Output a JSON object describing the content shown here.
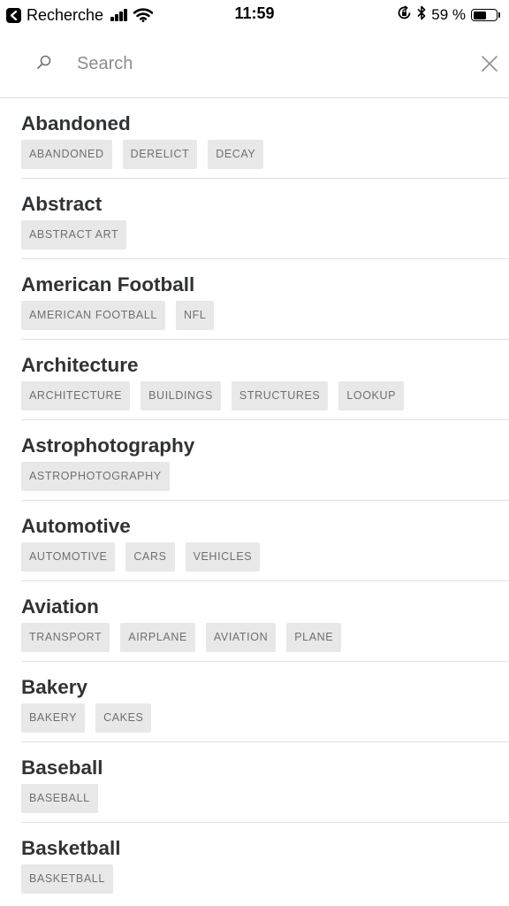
{
  "status_bar": {
    "back_app": "Recherche",
    "time": "11:59",
    "battery_text": "59 %",
    "battery_level": 0.59,
    "icons": [
      "back-arrow-icon",
      "signal-icon",
      "wifi-icon",
      "orientation-lock-icon",
      "bluetooth-icon",
      "battery-icon"
    ]
  },
  "search": {
    "placeholder": "Search",
    "value": "",
    "icons": [
      "search-icon",
      "close-icon"
    ]
  },
  "categories": [
    {
      "title": "Abandoned",
      "tags": [
        "ABANDONED",
        "DERELICT",
        "DECAY"
      ]
    },
    {
      "title": "Abstract",
      "tags": [
        "ABSTRACT ART"
      ]
    },
    {
      "title": "American Football",
      "tags": [
        "AMERICAN FOOTBALL",
        "NFL"
      ]
    },
    {
      "title": "Architecture",
      "tags": [
        "ARCHITECTURE",
        "BUILDINGS",
        "STRUCTURES",
        "LOOKUP"
      ]
    },
    {
      "title": "Astrophotography",
      "tags": [
        "ASTROPHOTOGRAPHY"
      ]
    },
    {
      "title": "Automotive",
      "tags": [
        "AUTOMOTIVE",
        "CARS",
        "VEHICLES"
      ]
    },
    {
      "title": "Aviation",
      "tags": [
        "TRANSPORT",
        "AIRPLANE",
        "AVIATION",
        "PLANE"
      ]
    },
    {
      "title": "Bakery",
      "tags": [
        "BAKERY",
        "CAKES"
      ]
    },
    {
      "title": "Baseball",
      "tags": [
        "BASEBALL"
      ]
    },
    {
      "title": "Basketball",
      "tags": [
        "BASKETBALL"
      ]
    }
  ],
  "colors": {
    "tag_background": "#e8e8e8",
    "tag_text": "#6d7073",
    "title_text": "#2f3336",
    "divider": "#e1e1e1"
  }
}
